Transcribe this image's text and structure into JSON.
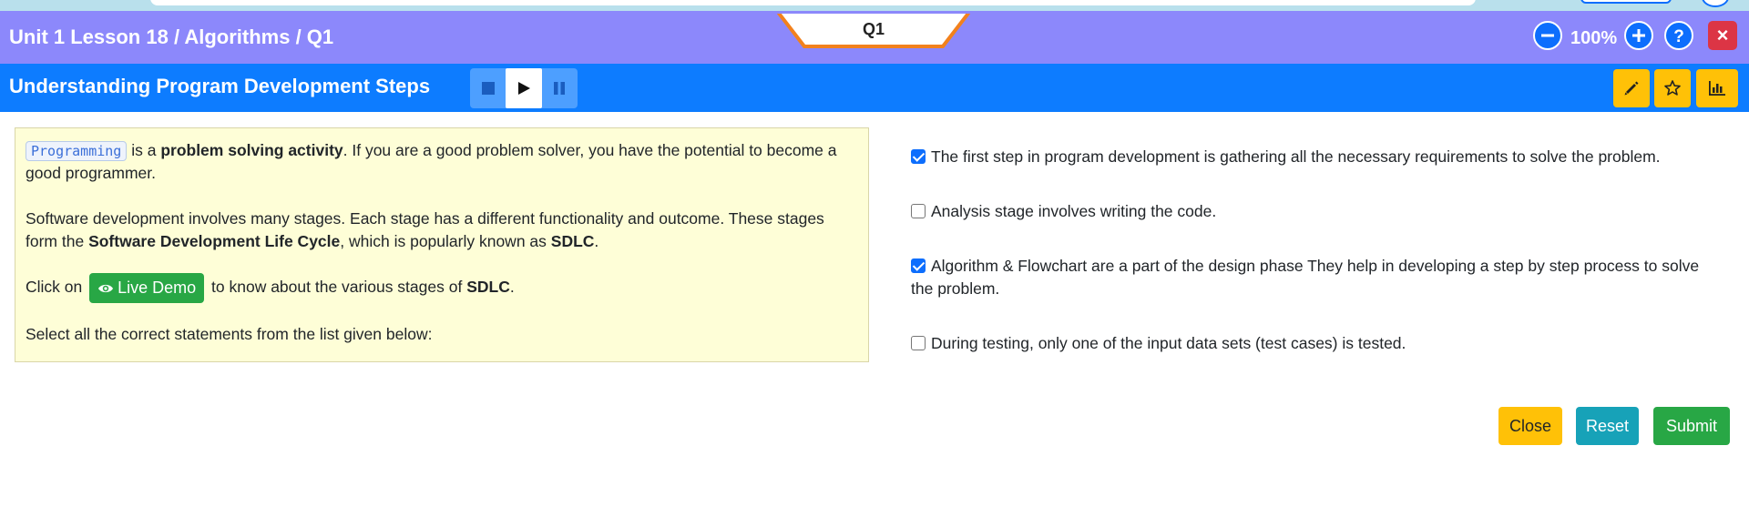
{
  "header": {
    "lesson_title": "Unit 1 Lesson 18 / Algorithms / Q1",
    "question_tab": "Q1",
    "zoom_level": "100%",
    "close_symbol": "×"
  },
  "subheader": {
    "title": "Understanding Program Development Steps",
    "media_controls": [
      "stop",
      "play",
      "pause"
    ],
    "tools": [
      "pencil-icon",
      "star-icon",
      "bar-chart-icon"
    ]
  },
  "question": {
    "p1_chip": "Programming",
    "p1_text1": " is a ",
    "p1_bold": "problem solving activity",
    "p1_text2": ". If you are a good problem solver, you have the potential to become a good programmer.",
    "p2_text1": "Software development involves many stages. Each stage has a different functionality and outcome. These stages form the ",
    "p2_bold1": "Software Development Life Cycle",
    "p2_text2": ", which is popularly known as ",
    "p2_bold2": "SDLC",
    "p2_text3": ".",
    "p3_text1": "Click on ",
    "live_demo_label": "Live Demo",
    "p3_text2": " to know about the various stages of ",
    "p3_bold": "SDLC",
    "p3_text3": ".",
    "p4_text": "Select all the correct statements from the list given below:"
  },
  "options": [
    {
      "text": "The first step in program development is gathering all the necessary requirements to solve the problem.",
      "checked": true
    },
    {
      "text": "Analysis stage involves writing the code.",
      "checked": false
    },
    {
      "text": "Algorithm & Flowchart are a part of the design phase They help in developing a step by step process to solve the problem.",
      "checked": true
    },
    {
      "text": "During testing, only one of the input data sets (test cases) is tested.",
      "checked": false
    }
  ],
  "actions": {
    "close_label": "Close",
    "reset_label": "Reset",
    "submit_label": "Submit"
  },
  "colors": {
    "title_bar": "#8c88fb",
    "sub_bar": "#0d7cff",
    "close": "#ffc107",
    "reset": "#17a2b8",
    "submit": "#28a745"
  }
}
